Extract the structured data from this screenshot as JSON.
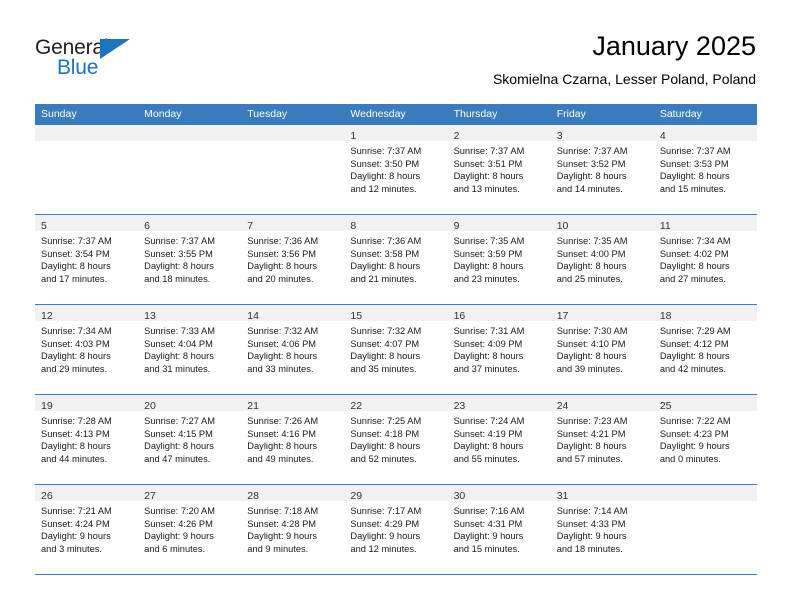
{
  "brand": {
    "name_top": "General",
    "name_bottom": "Blue",
    "triangle_icon": "triangle-icon",
    "colors": {
      "blue": "#1e73be",
      "dark": "#231f20"
    }
  },
  "header": {
    "title": "January 2025",
    "subtitle": "Skomielna Czarna, Lesser Poland, Poland"
  },
  "theme": {
    "header_row_bg": "#3a7cbe",
    "day_band_bg": "#f1f1f1",
    "separator": "#3a7cbe",
    "cell_bg": "#ffffff"
  },
  "weekdays": [
    "Sunday",
    "Monday",
    "Tuesday",
    "Wednesday",
    "Thursday",
    "Friday",
    "Saturday"
  ],
  "weeks": [
    [
      {
        "day": "",
        "lines": []
      },
      {
        "day": "",
        "lines": []
      },
      {
        "day": "",
        "lines": []
      },
      {
        "day": "1",
        "lines": [
          "Sunrise: 7:37 AM",
          "Sunset: 3:50 PM",
          "Daylight: 8 hours",
          "and 12 minutes."
        ]
      },
      {
        "day": "2",
        "lines": [
          "Sunrise: 7:37 AM",
          "Sunset: 3:51 PM",
          "Daylight: 8 hours",
          "and 13 minutes."
        ]
      },
      {
        "day": "3",
        "lines": [
          "Sunrise: 7:37 AM",
          "Sunset: 3:52 PM",
          "Daylight: 8 hours",
          "and 14 minutes."
        ]
      },
      {
        "day": "4",
        "lines": [
          "Sunrise: 7:37 AM",
          "Sunset: 3:53 PM",
          "Daylight: 8 hours",
          "and 15 minutes."
        ]
      }
    ],
    [
      {
        "day": "5",
        "lines": [
          "Sunrise: 7:37 AM",
          "Sunset: 3:54 PM",
          "Daylight: 8 hours",
          "and 17 minutes."
        ]
      },
      {
        "day": "6",
        "lines": [
          "Sunrise: 7:37 AM",
          "Sunset: 3:55 PM",
          "Daylight: 8 hours",
          "and 18 minutes."
        ]
      },
      {
        "day": "7",
        "lines": [
          "Sunrise: 7:36 AM",
          "Sunset: 3:56 PM",
          "Daylight: 8 hours",
          "and 20 minutes."
        ]
      },
      {
        "day": "8",
        "lines": [
          "Sunrise: 7:36 AM",
          "Sunset: 3:58 PM",
          "Daylight: 8 hours",
          "and 21 minutes."
        ]
      },
      {
        "day": "9",
        "lines": [
          "Sunrise: 7:35 AM",
          "Sunset: 3:59 PM",
          "Daylight: 8 hours",
          "and 23 minutes."
        ]
      },
      {
        "day": "10",
        "lines": [
          "Sunrise: 7:35 AM",
          "Sunset: 4:00 PM",
          "Daylight: 8 hours",
          "and 25 minutes."
        ]
      },
      {
        "day": "11",
        "lines": [
          "Sunrise: 7:34 AM",
          "Sunset: 4:02 PM",
          "Daylight: 8 hours",
          "and 27 minutes."
        ]
      }
    ],
    [
      {
        "day": "12",
        "lines": [
          "Sunrise: 7:34 AM",
          "Sunset: 4:03 PM",
          "Daylight: 8 hours",
          "and 29 minutes."
        ]
      },
      {
        "day": "13",
        "lines": [
          "Sunrise: 7:33 AM",
          "Sunset: 4:04 PM",
          "Daylight: 8 hours",
          "and 31 minutes."
        ]
      },
      {
        "day": "14",
        "lines": [
          "Sunrise: 7:32 AM",
          "Sunset: 4:06 PM",
          "Daylight: 8 hours",
          "and 33 minutes."
        ]
      },
      {
        "day": "15",
        "lines": [
          "Sunrise: 7:32 AM",
          "Sunset: 4:07 PM",
          "Daylight: 8 hours",
          "and 35 minutes."
        ]
      },
      {
        "day": "16",
        "lines": [
          "Sunrise: 7:31 AM",
          "Sunset: 4:09 PM",
          "Daylight: 8 hours",
          "and 37 minutes."
        ]
      },
      {
        "day": "17",
        "lines": [
          "Sunrise: 7:30 AM",
          "Sunset: 4:10 PM",
          "Daylight: 8 hours",
          "and 39 minutes."
        ]
      },
      {
        "day": "18",
        "lines": [
          "Sunrise: 7:29 AM",
          "Sunset: 4:12 PM",
          "Daylight: 8 hours",
          "and 42 minutes."
        ]
      }
    ],
    [
      {
        "day": "19",
        "lines": [
          "Sunrise: 7:28 AM",
          "Sunset: 4:13 PM",
          "Daylight: 8 hours",
          "and 44 minutes."
        ]
      },
      {
        "day": "20",
        "lines": [
          "Sunrise: 7:27 AM",
          "Sunset: 4:15 PM",
          "Daylight: 8 hours",
          "and 47 minutes."
        ]
      },
      {
        "day": "21",
        "lines": [
          "Sunrise: 7:26 AM",
          "Sunset: 4:16 PM",
          "Daylight: 8 hours",
          "and 49 minutes."
        ]
      },
      {
        "day": "22",
        "lines": [
          "Sunrise: 7:25 AM",
          "Sunset: 4:18 PM",
          "Daylight: 8 hours",
          "and 52 minutes."
        ]
      },
      {
        "day": "23",
        "lines": [
          "Sunrise: 7:24 AM",
          "Sunset: 4:19 PM",
          "Daylight: 8 hours",
          "and 55 minutes."
        ]
      },
      {
        "day": "24",
        "lines": [
          "Sunrise: 7:23 AM",
          "Sunset: 4:21 PM",
          "Daylight: 8 hours",
          "and 57 minutes."
        ]
      },
      {
        "day": "25",
        "lines": [
          "Sunrise: 7:22 AM",
          "Sunset: 4:23 PM",
          "Daylight: 9 hours",
          "and 0 minutes."
        ]
      }
    ],
    [
      {
        "day": "26",
        "lines": [
          "Sunrise: 7:21 AM",
          "Sunset: 4:24 PM",
          "Daylight: 9 hours",
          "and 3 minutes."
        ]
      },
      {
        "day": "27",
        "lines": [
          "Sunrise: 7:20 AM",
          "Sunset: 4:26 PM",
          "Daylight: 9 hours",
          "and 6 minutes."
        ]
      },
      {
        "day": "28",
        "lines": [
          "Sunrise: 7:18 AM",
          "Sunset: 4:28 PM",
          "Daylight: 9 hours",
          "and 9 minutes."
        ]
      },
      {
        "day": "29",
        "lines": [
          "Sunrise: 7:17 AM",
          "Sunset: 4:29 PM",
          "Daylight: 9 hours",
          "and 12 minutes."
        ]
      },
      {
        "day": "30",
        "lines": [
          "Sunrise: 7:16 AM",
          "Sunset: 4:31 PM",
          "Daylight: 9 hours",
          "and 15 minutes."
        ]
      },
      {
        "day": "31",
        "lines": [
          "Sunrise: 7:14 AM",
          "Sunset: 4:33 PM",
          "Daylight: 9 hours",
          "and 18 minutes."
        ]
      },
      {
        "day": "",
        "lines": []
      }
    ]
  ]
}
